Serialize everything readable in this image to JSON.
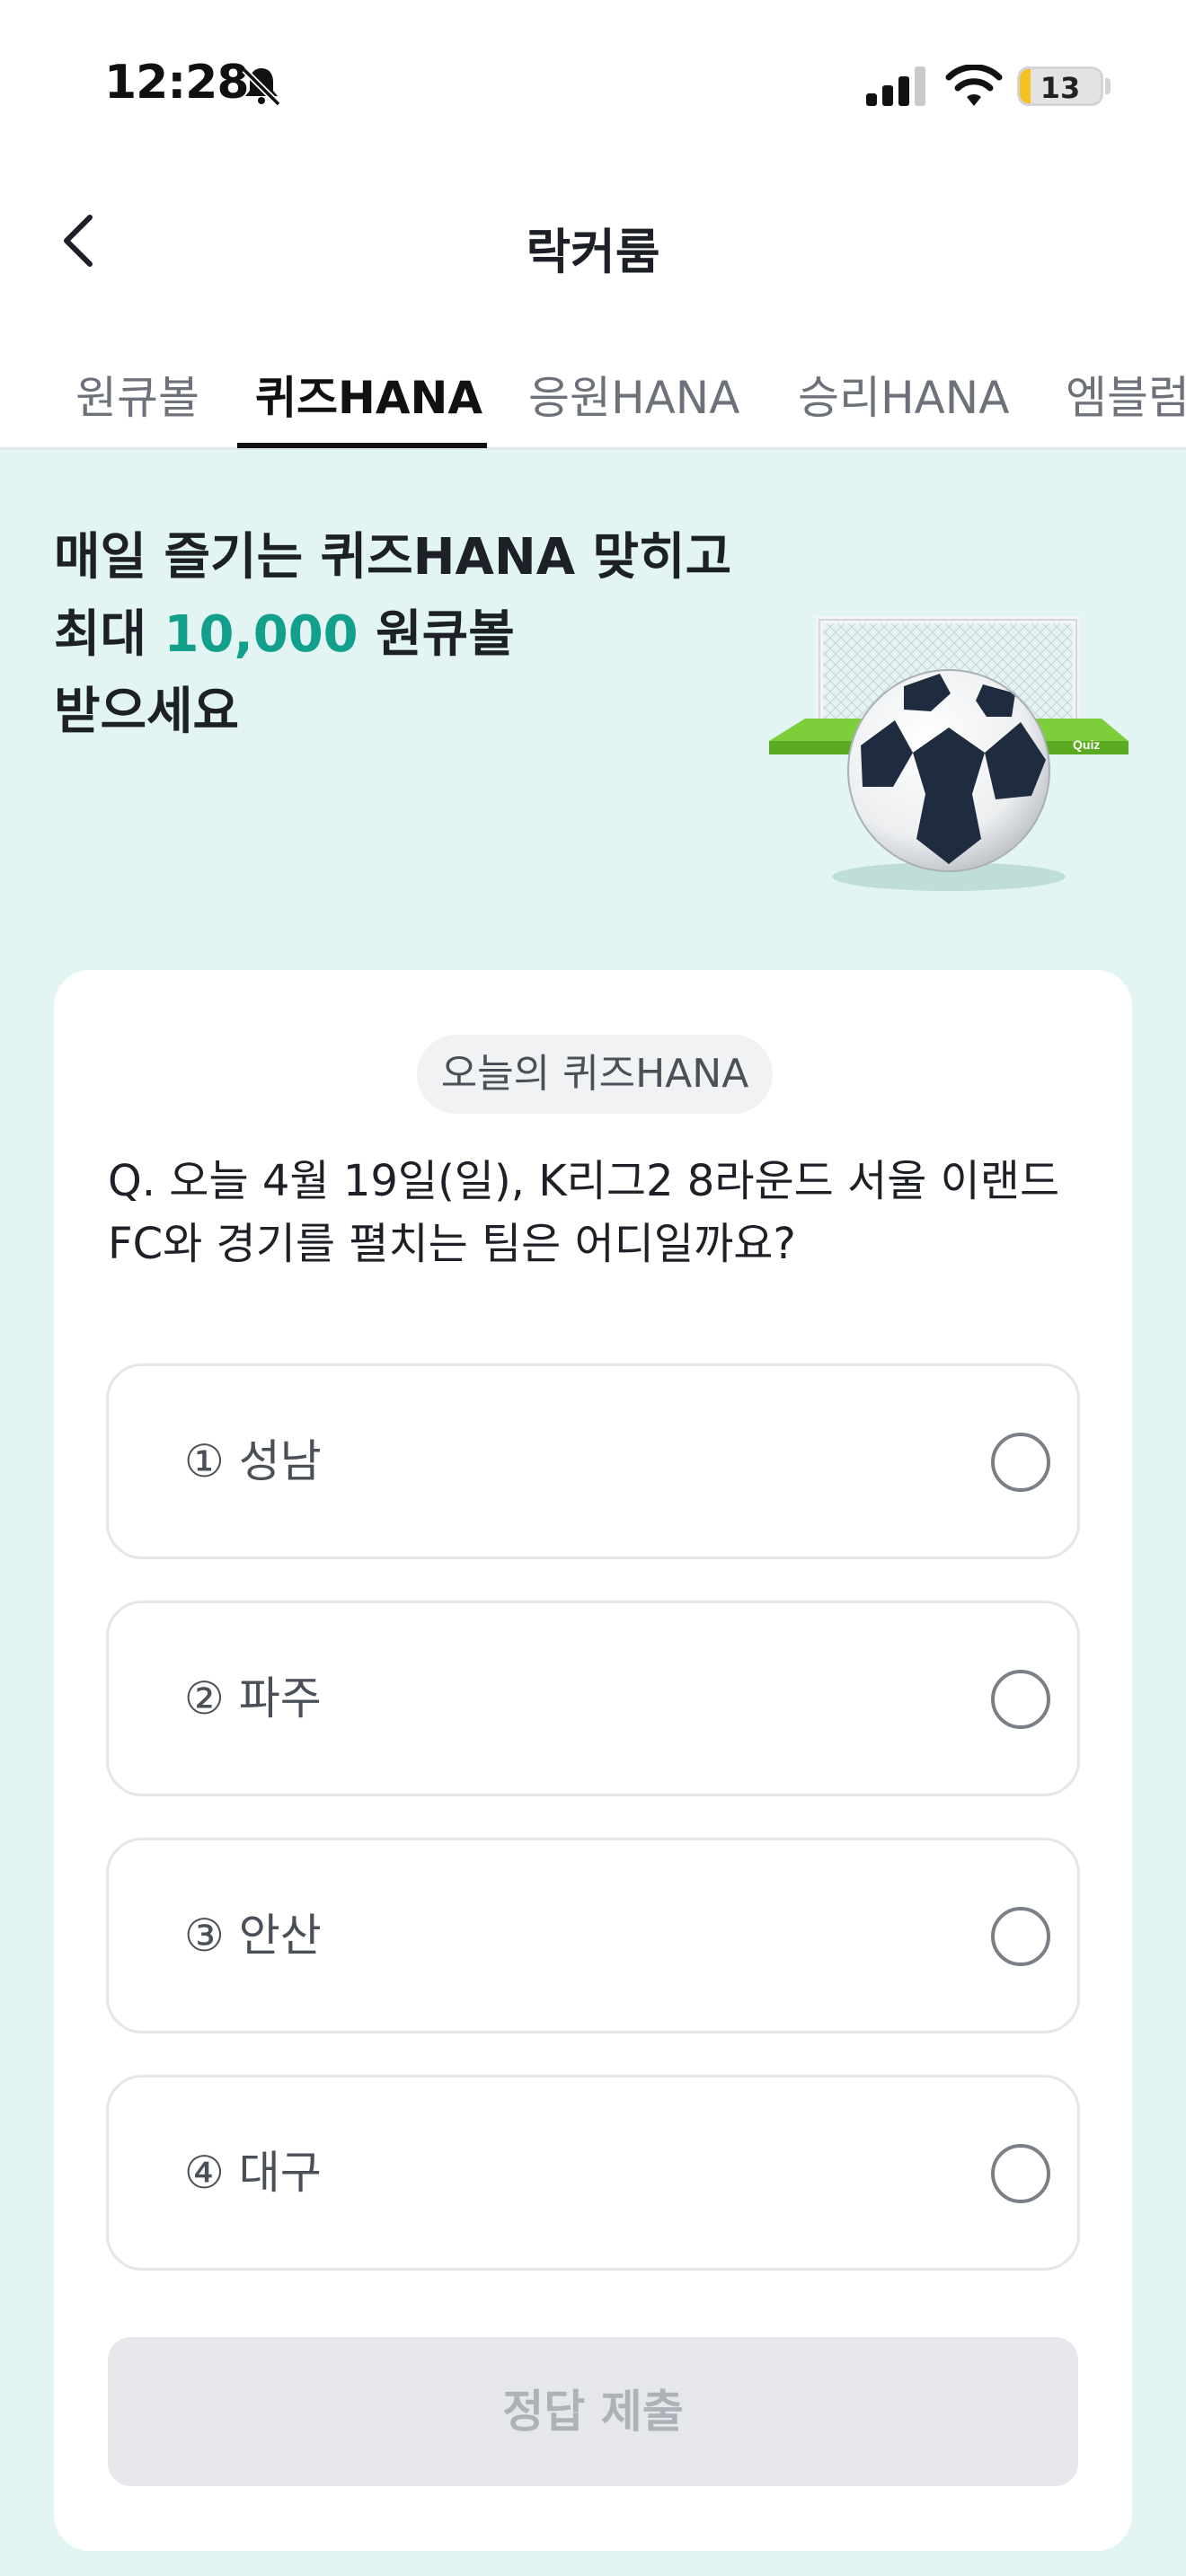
{
  "status_bar": {
    "time": "12:28",
    "battery": "13"
  },
  "header": {
    "title": "락커룸"
  },
  "tabs": [
    {
      "label": "원큐볼",
      "active": false
    },
    {
      "label": "퀴즈HANA",
      "active": true
    },
    {
      "label": "응원HANA",
      "active": false
    },
    {
      "label": "승리HANA",
      "active": false
    },
    {
      "label": "엠블럼",
      "active": false
    }
  ],
  "banner": {
    "line1": "매일 즐기는 퀴즈HANA 맞히고",
    "line2_prefix": "최대 ",
    "line2_amount": "10,000",
    "line2_suffix": " 원큐볼",
    "line3": "받으세요",
    "art_caption": "Quiz",
    "accent_color": "#12a08c"
  },
  "quiz": {
    "chip": "오늘의 퀴즈HANA",
    "question": "Q. 오늘 4월 19일(일), K리그2 8라운드 서울 이랜드 FC와 경기를 펼치는 팀은 어디일까요?",
    "options": [
      {
        "label": "① 성남",
        "selected": false
      },
      {
        "label": "② 파주",
        "selected": false
      },
      {
        "label": "③ 안산",
        "selected": false
      },
      {
        "label": "④ 대구",
        "selected": false
      }
    ],
    "submit_label": "정답 제출"
  }
}
